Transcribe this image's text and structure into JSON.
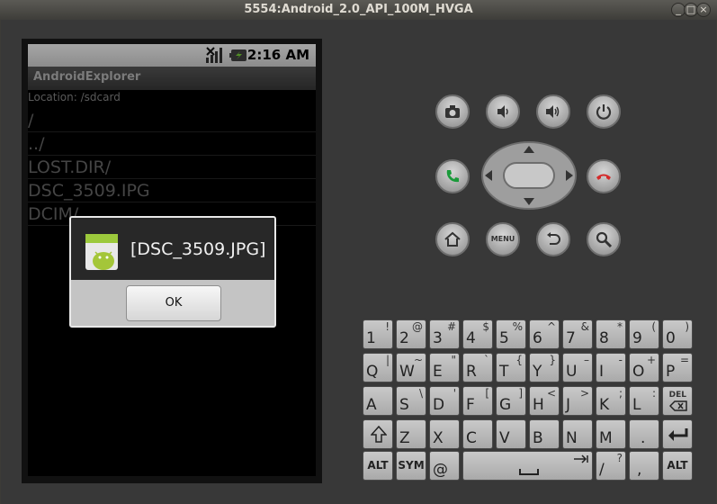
{
  "window": {
    "title": "5554:Android_2.0_API_100M_HVGA",
    "buttons": [
      "_",
      "□",
      "×"
    ]
  },
  "device": {
    "status_bar": {
      "time": "2:16 AM",
      "icons": [
        "signal-icon",
        "battery-charging-icon"
      ]
    },
    "app_title": "AndroidExplorer",
    "location": "Location: /sdcard",
    "files": [
      "/",
      "../",
      "LOST.DIR/",
      "DSC_3509.IPG",
      "DCIM/"
    ],
    "dialog": {
      "message": "[DSC_3509.JPG]",
      "ok_label": "OK",
      "icon": "android-app-icon"
    }
  },
  "hardware_buttons": {
    "row1": [
      "camera-icon",
      "volume-down-icon",
      "volume-up-icon",
      "power-icon"
    ],
    "row2": [
      "call-icon",
      "dpad",
      "end-call-icon"
    ],
    "row3": [
      "home-icon",
      "menu-button",
      "back-icon",
      "search-icon"
    ],
    "menu_label": "MENU"
  },
  "keyboard": {
    "row1": [
      [
        "1",
        "!"
      ],
      [
        "2",
        "@"
      ],
      [
        "3",
        "#"
      ],
      [
        "4",
        "$"
      ],
      [
        "5",
        "%"
      ],
      [
        "6",
        "^"
      ],
      [
        "7",
        "&"
      ],
      [
        "8",
        "*"
      ],
      [
        "9",
        "("
      ],
      [
        "0",
        ")"
      ]
    ],
    "row2": [
      [
        "Q",
        "|"
      ],
      [
        "W",
        "~"
      ],
      [
        "E",
        "\""
      ],
      [
        "R",
        "`"
      ],
      [
        "T",
        "{"
      ],
      [
        "Y",
        "}"
      ],
      [
        "U",
        "–"
      ],
      [
        "I",
        "-"
      ],
      [
        "O",
        "+"
      ],
      [
        "P",
        "="
      ]
    ],
    "row3": [
      [
        "A",
        ""
      ],
      [
        "S",
        "\\"
      ],
      [
        "D",
        "'"
      ],
      [
        "F",
        "["
      ],
      [
        "G",
        "]"
      ],
      [
        "H",
        "<"
      ],
      [
        "J",
        ">"
      ],
      [
        "K",
        ";"
      ],
      [
        "L",
        ":"
      ]
    ],
    "del_label": "DEL",
    "row4": [
      [
        "Z",
        ""
      ],
      [
        "X",
        ""
      ],
      [
        "C",
        ""
      ],
      [
        "V",
        ""
      ],
      [
        "B",
        ""
      ],
      [
        "N",
        ""
      ],
      [
        "M",
        ""
      ],
      [
        ".",
        ""
      ]
    ],
    "alt_label": "ALT",
    "sym_label": "SYM",
    "at_label": "@",
    "slash_label": "/",
    "slash_alt": "?",
    "comma_label": ","
  },
  "colors": {
    "screen_bg": "#000000",
    "dialog_head": "#282828",
    "dialog_foot": "#c4c4c4",
    "frame": "#383838"
  }
}
